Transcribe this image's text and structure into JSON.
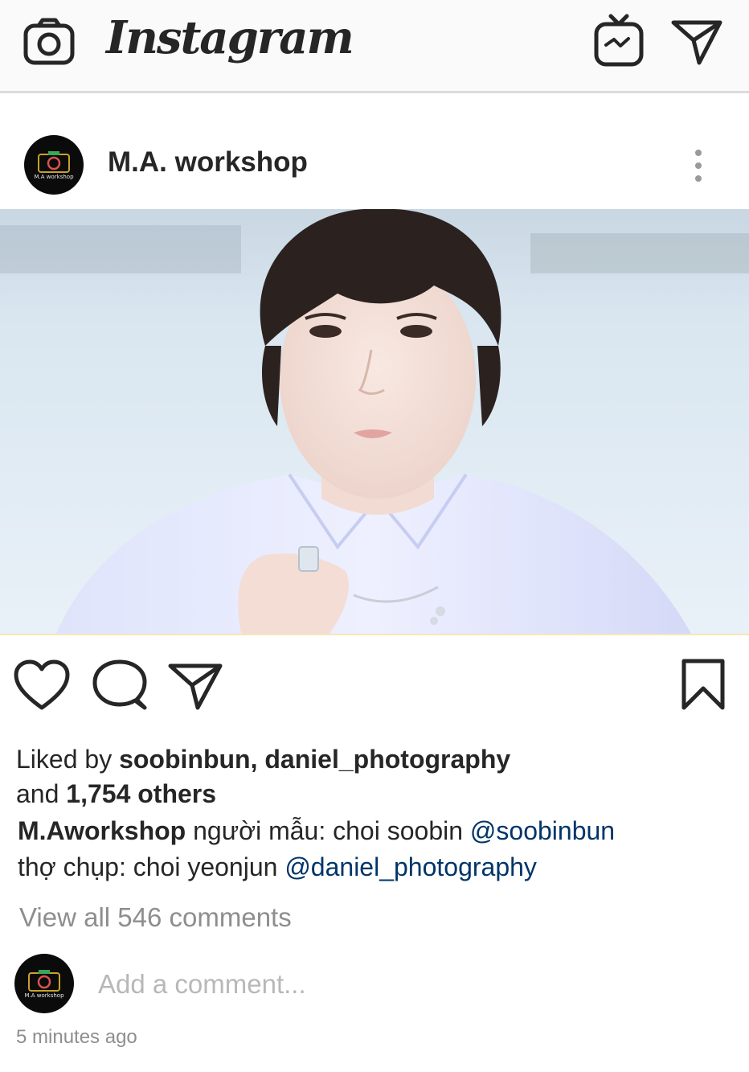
{
  "app": {
    "title": "Instagram"
  },
  "topbar": {
    "left_icon": "camera-icon",
    "right_icons": [
      "igtv-icon",
      "direct-message-icon"
    ]
  },
  "post": {
    "username": "M.A. workshop",
    "avatar_text": "M.A workshop",
    "actions": [
      "heart-icon",
      "comment-icon",
      "share-icon",
      "bookmark-icon"
    ],
    "likes": {
      "prefix": "Liked by ",
      "users": "soobinbun, daniel_photography",
      "line2_prefix": "and ",
      "others": "1,754 others"
    },
    "caption": {
      "author": "M.Aworkshop",
      "line1_text": " người mẫu: choi soobin ",
      "line1_mention": "@soobinbun",
      "line2_text": "thợ chụp: choi yeonjun ",
      "line2_mention": "@daniel_photography"
    },
    "view_comments": "View all 546 comments",
    "add_comment_placeholder": "Add a comment...",
    "timestamp": "5 minutes ago"
  },
  "colors": {
    "text": "#262626",
    "secondary": "#8e8e8e",
    "mention": "#003569",
    "topbar_bg": "#fafafa",
    "divider": "#dbdbdb"
  }
}
